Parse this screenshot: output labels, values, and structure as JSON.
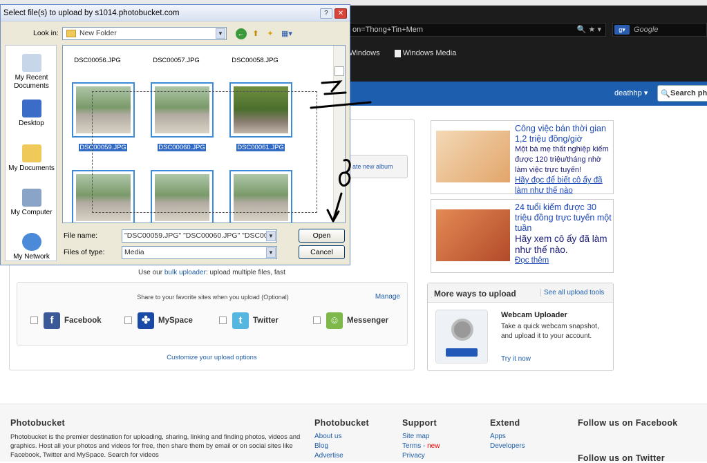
{
  "browser": {
    "url_fragment": "on=Thong+Tin+Mem",
    "search_engine": "Google",
    "bookmarks": [
      "Windows",
      "Windows Media"
    ]
  },
  "site_header": {
    "user": "deathhp",
    "search_placeholder": "Search ph"
  },
  "upload": {
    "album_button": "ate new album",
    "bulk_prefix": "Use our",
    "bulk_link": "bulk uploader",
    "bulk_suffix": ": upload multiple files, fast",
    "share_text": "Share to your favorite sites when you upload (Optional)",
    "manage": "Manage",
    "sites": [
      "Facebook",
      "MySpace",
      "Twitter",
      "Messenger"
    ],
    "customize": "Customize your upload options"
  },
  "ads": [
    {
      "title": "Công việc bán thời gian 1,2 triệu đồng/giờ",
      "body": "Một bà mẹ thất nghiệp kiếm được 120 triệu/tháng nhờ làm việc trực tuyến!",
      "link": "Hãy đọc để biết cô ấy đã làm như thế nào"
    },
    {
      "title": "24 tuổi kiếm được 30 triệu đồng trực tuyến một tuần",
      "body": "Hãy xem cô ấy đã làm như thế nào.",
      "link": "Đọc thêm"
    }
  ],
  "more_ways": {
    "title": "More ways to upload",
    "see_all": "See all upload tools",
    "tool_title": "Webcam Uploader",
    "tool_desc": "Take a quick webcam snapshot, and upload it to your account.",
    "try": "Try it now"
  },
  "footer": {
    "brand": "Photobucket",
    "description": "Photobucket is the premier destination for uploading, sharing, linking and finding photos, videos and graphics. Host all your photos and videos for free, then share them by email or on social sites like Facebook, Twitter and MySpace. Search for videos",
    "col1_title": "Photobucket",
    "col1_links": [
      "About us",
      "Blog",
      "Advertise"
    ],
    "col2_title": "Support",
    "col2_links": [
      "Site map",
      "Terms -",
      "Privacy"
    ],
    "new_badge": "new",
    "col3_title": "Extend",
    "col3_links": [
      "Apps",
      "Developers"
    ],
    "follow_fb": "Follow us on Facebook",
    "follow_tw": "Follow us on Twitter"
  },
  "dialog": {
    "title": "Select file(s) to upload by s1014.photobucket.com",
    "help_btn": "?",
    "close_btn": "✕",
    "look_in_label": "Look in:",
    "look_in_value": "New Folder",
    "places": [
      "My Recent Documents",
      "Desktop",
      "My Documents",
      "My Computer",
      "My Network"
    ],
    "files_row1": [
      "DSC00056.JPG",
      "DSC00057.JPG",
      "DSC00058.JPG"
    ],
    "files_row2": [
      "DSC00059.JPG",
      "DSC00060.JPG",
      "DSC00061.JPG"
    ],
    "file_name_label": "File name:",
    "file_name_value": "\"DSC00059.JPG\" \"DSC00060.JPG\" \"DSC000",
    "file_type_label": "Files of type:",
    "file_type_value": "Media",
    "open": "Open",
    "cancel": "Cancel"
  },
  "annotations": [
    "7",
    "8"
  ]
}
